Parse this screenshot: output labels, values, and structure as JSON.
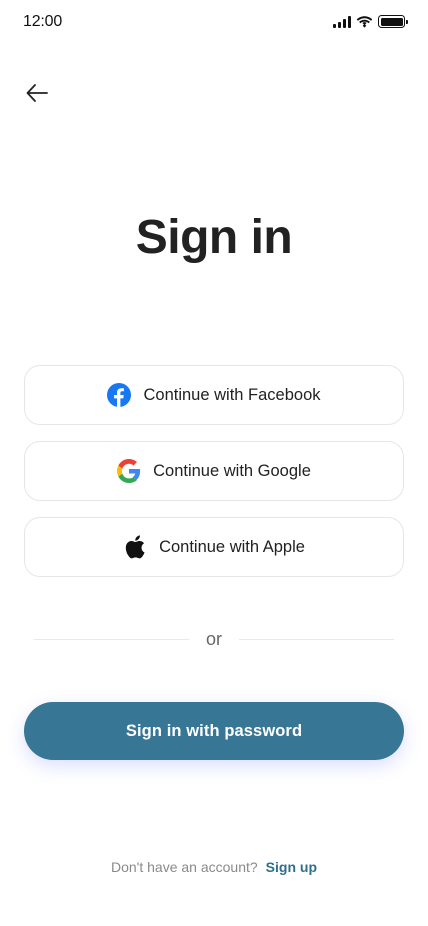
{
  "status_bar": {
    "time": "12:00"
  },
  "header": {
    "title": "Sign in"
  },
  "social": {
    "facebook_label": "Continue with Facebook",
    "google_label": "Continue with Google",
    "apple_label": "Continue with Apple"
  },
  "divider": {
    "text": "or"
  },
  "primary": {
    "label": "Sign in with password"
  },
  "footer": {
    "prompt": "Don't have an account?",
    "link": "Sign up"
  },
  "colors": {
    "primary": "#377795",
    "link": "#2f6f8e",
    "facebook": "#1877F2",
    "google_blue": "#4285F4",
    "google_red": "#EA4335",
    "google_yellow": "#FBBC05",
    "google_green": "#34A853"
  },
  "icons": {
    "back": "arrow-left-icon",
    "facebook": "facebook-icon",
    "google": "google-icon",
    "apple": "apple-icon"
  }
}
